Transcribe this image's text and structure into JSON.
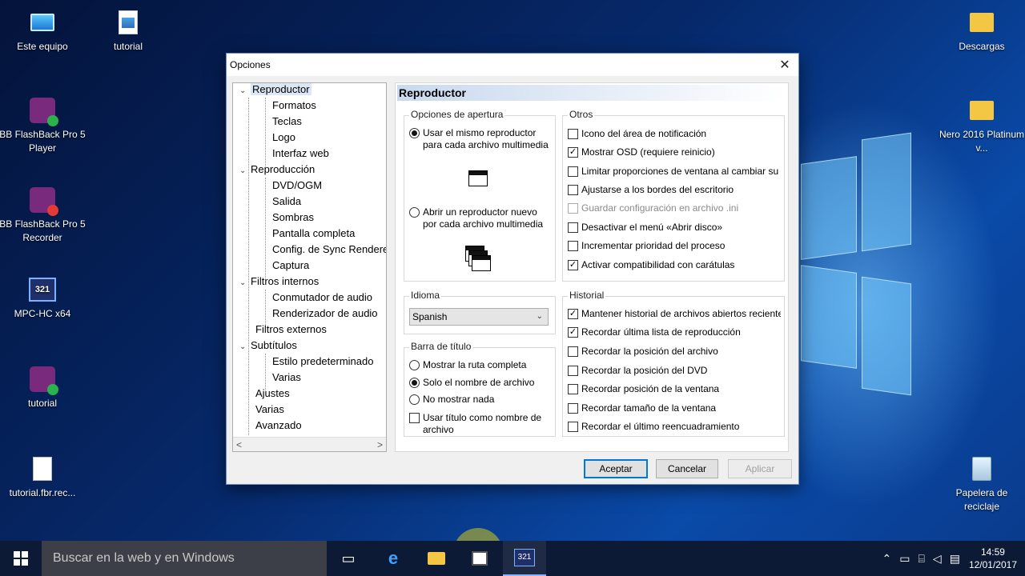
{
  "desktop": {
    "icons": [
      {
        "label": "Este equipo",
        "icon": "computer-icon"
      },
      {
        "label": "tutorial",
        "icon": "image-file-icon"
      },
      {
        "label": "BB FlashBack Pro 5 Player",
        "icon": "flashback-player-icon"
      },
      {
        "label": "BB FlashBack Pro 5 Recorder",
        "icon": "flashback-recorder-icon"
      },
      {
        "label": "MPC-HC x64",
        "icon": "mpc-hc-icon"
      },
      {
        "label": "tutorial",
        "icon": "flashback-movie-icon"
      },
      {
        "label": "tutorial.fbr.rec...",
        "icon": "file-icon"
      },
      {
        "label": "Descargas",
        "icon": "downloads-folder-icon"
      },
      {
        "label": "Nero 2016 Platinum v...",
        "icon": "nero-icon"
      },
      {
        "label": "Papelera de reciclaje",
        "icon": "recycle-bin-icon"
      }
    ]
  },
  "dialog": {
    "title": "Opciones",
    "close_glyph": "✕",
    "tree": [
      {
        "label": "Reproductor",
        "level": 0,
        "expanded": true,
        "selected": true
      },
      {
        "label": "Formatos",
        "level": 1
      },
      {
        "label": "Teclas",
        "level": 1
      },
      {
        "label": "Logo",
        "level": 1
      },
      {
        "label": "Interfaz web",
        "level": 1
      },
      {
        "label": "Reproducción",
        "level": 0,
        "expanded": true
      },
      {
        "label": "DVD/OGM",
        "level": 1
      },
      {
        "label": "Salida",
        "level": 1
      },
      {
        "label": "Sombras",
        "level": 1
      },
      {
        "label": "Pantalla completa",
        "level": 1
      },
      {
        "label": "Config. de Sync Rendere",
        "level": 1
      },
      {
        "label": "Captura",
        "level": 1
      },
      {
        "label": "Filtros internos",
        "level": 0,
        "expanded": true
      },
      {
        "label": "Conmutador de audio",
        "level": 1
      },
      {
        "label": "Renderizador de audio",
        "level": 1
      },
      {
        "label": "Filtros externos",
        "level": 0
      },
      {
        "label": "Subtítulos",
        "level": 0,
        "expanded": true
      },
      {
        "label": "Estilo predeterminado",
        "level": 1
      },
      {
        "label": "Varias",
        "level": 1
      },
      {
        "label": "Ajustes",
        "level": 0
      },
      {
        "label": "Varias",
        "level": 0
      },
      {
        "label": "Avanzado",
        "level": 0
      }
    ],
    "panel_title": "Reproductor",
    "apertura": {
      "title": "Opciones de apertura",
      "opt1": "Usar el mismo reproductor",
      "opt1b": "para cada archivo multimedia",
      "opt2": "Abrir un reproductor nuevo",
      "opt2b": "por cada archivo multimedia",
      "selected": 1
    },
    "idioma": {
      "title": "Idioma",
      "value": "Spanish"
    },
    "barra": {
      "title": "Barra de título",
      "options": [
        "Mostrar la ruta completa",
        "Solo el nombre de archivo",
        "No mostrar nada"
      ],
      "selected": 2,
      "checkbox": "Usar título como nombre de",
      "checkbox_b": "archivo",
      "checkbox_checked": false
    },
    "otros": {
      "title": "Otros",
      "items": [
        {
          "label": "Icono del área de notificación",
          "checked": false
        },
        {
          "label": "Mostrar OSD (requiere reinicio)",
          "checked": true
        },
        {
          "label": "Limitar proporciones de ventana al cambiar su t",
          "checked": false
        },
        {
          "label": "Ajustarse a los bordes del escritorio",
          "checked": false
        },
        {
          "label": "Guardar configuración en archivo .ini",
          "checked": false,
          "disabled": true
        },
        {
          "label": "Desactivar el menú «Abrir disco»",
          "checked": false
        },
        {
          "label": "Incrementar prioridad del proceso",
          "checked": false
        },
        {
          "label": "Activar compatibilidad con carátulas",
          "checked": true
        }
      ]
    },
    "historial": {
      "title": "Historial",
      "items": [
        {
          "label": "Mantener historial de archivos abiertos reciente",
          "checked": true
        },
        {
          "label": "Recordar última lista de reproducción",
          "checked": true
        },
        {
          "label": "Recordar la posición del archivo",
          "checked": false
        },
        {
          "label": "Recordar la posición del DVD",
          "checked": false
        },
        {
          "label": "Recordar posición de la ventana",
          "checked": false
        },
        {
          "label": "Recordar tamaño de la ventana",
          "checked": false
        },
        {
          "label": "Recordar el último reencuadramiento",
          "checked": false
        }
      ]
    },
    "buttons": {
      "accept": "Aceptar",
      "cancel": "Cancelar",
      "apply": "Aplicar"
    },
    "scroll_left": "<",
    "scroll_right": ">"
  },
  "taskbar": {
    "search_placeholder": "Buscar en la web y en Windows",
    "time": "14:59",
    "date": "12/01/2017",
    "mpc_badge": "321"
  }
}
